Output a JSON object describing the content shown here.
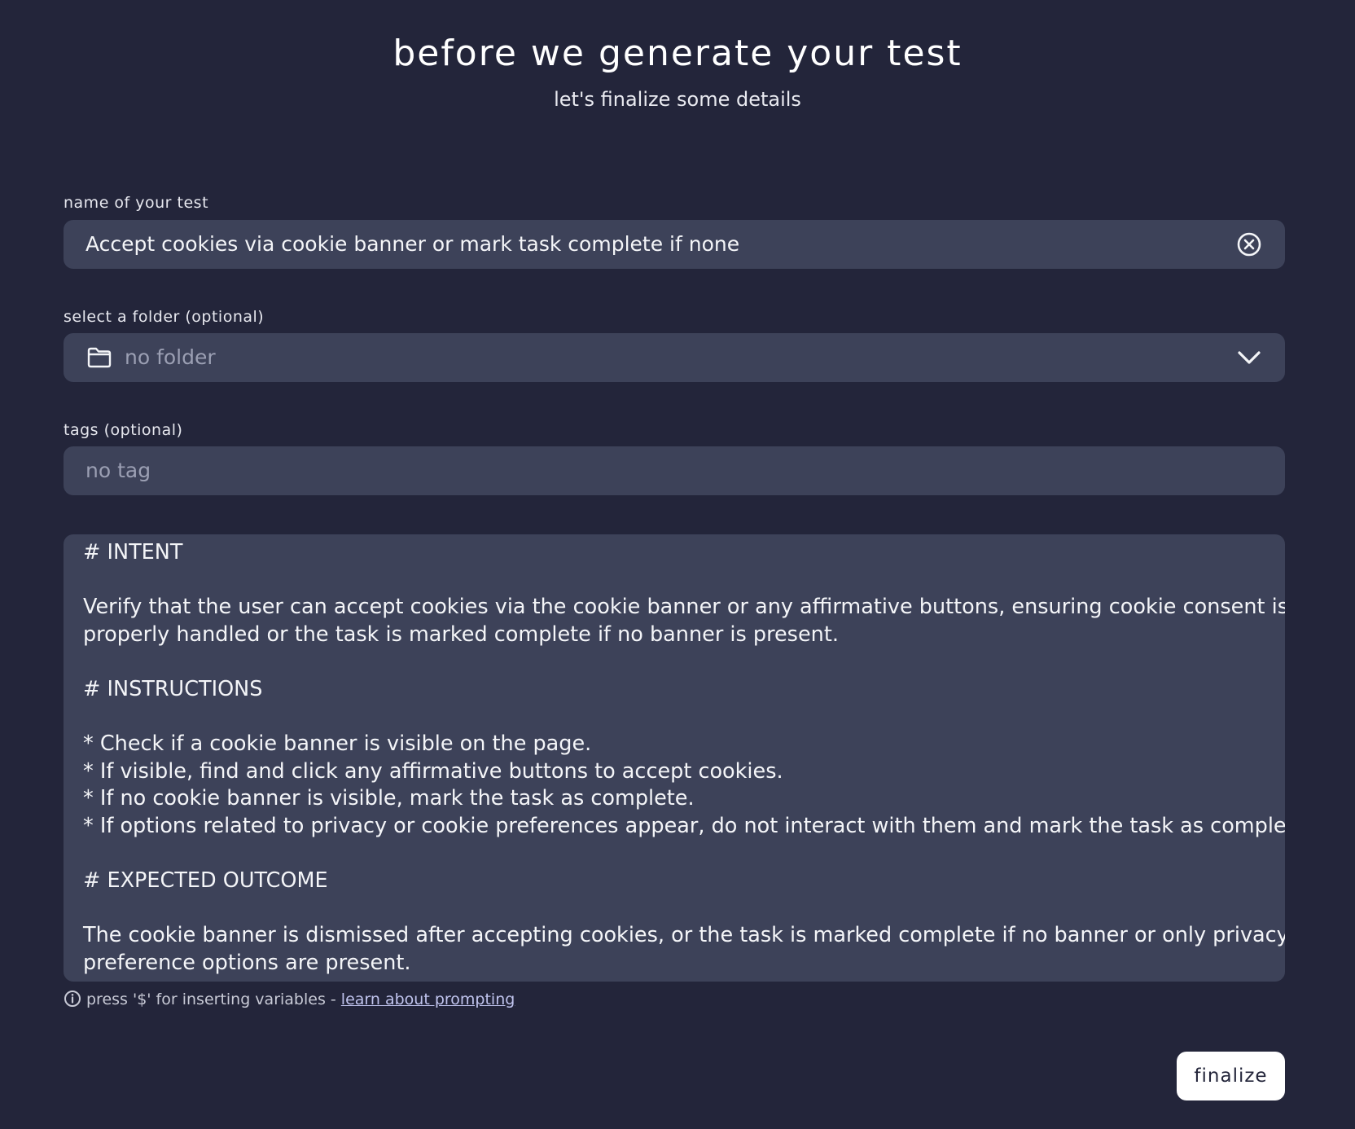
{
  "header": {
    "title": "before we generate your test",
    "subtitle": "let's finalize some details"
  },
  "name_field": {
    "label": "name of your test",
    "value": "Accept cookies via cookie banner or mark task complete if none",
    "clear_icon": "circle-x-icon"
  },
  "folder_field": {
    "label": "select a folder (optional)",
    "placeholder": "no folder",
    "icon": "folder-icon",
    "dropdown_icon": "chevron-down-icon"
  },
  "tags_field": {
    "label": "tags (optional)",
    "placeholder": "no tag"
  },
  "prompt": {
    "lines": [
      "# INTENT",
      "",
      "Verify that the user can accept cookies via the cookie banner or any affirmative buttons, ensuring cookie consent is",
      "properly handled or the task is marked complete if no banner is present.",
      "",
      "# INSTRUCTIONS",
      "",
      "* Check if a cookie banner is visible on the page.",
      "* If visible, find and click any affirmative buttons to accept cookies.",
      "* If no cookie banner is visible, mark the task as complete.",
      "* If options related to privacy or cookie preferences appear, do not interact with them and mark the task as complete.",
      "",
      "# EXPECTED OUTCOME",
      "",
      "The cookie banner is dismissed after accepting cookies, or the task is marked complete if no banner or only privacy/cookie",
      "preference options are present."
    ]
  },
  "hint": {
    "icon": "info-icon",
    "text": "press '$' for inserting variables - ",
    "link_text": "learn about prompting"
  },
  "actions": {
    "finalize_label": "finalize"
  },
  "colors": {
    "background": "#23253a",
    "field_background": "#3d4259",
    "text": "#f4f5f8",
    "placeholder": "#9b9fb3",
    "link": "#c0c4ee",
    "button_background": "#ffffff"
  }
}
